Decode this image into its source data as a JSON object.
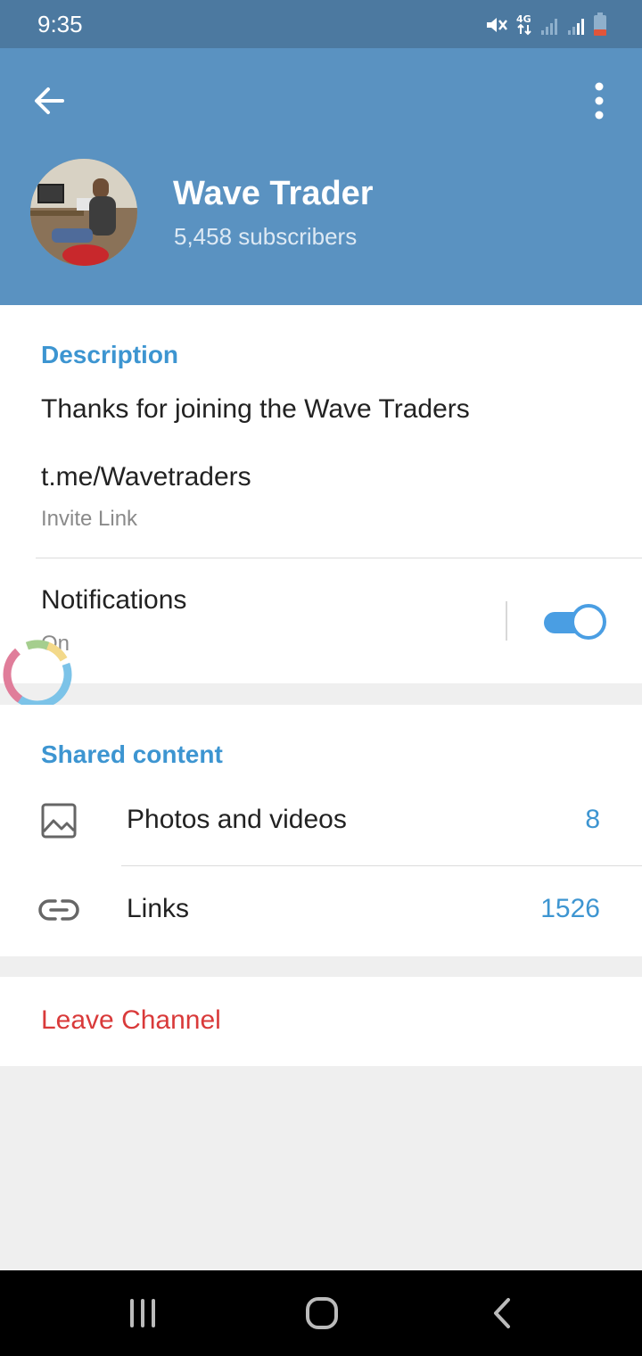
{
  "status_bar": {
    "time": "9:35",
    "icons": [
      "mute-icon",
      "4g-icon",
      "signal-icon",
      "signal-icon",
      "battery-icon"
    ]
  },
  "header": {
    "title": "Wave Trader",
    "subtitle": "5,458 subscribers",
    "accent_color": "#5a92c1"
  },
  "info": {
    "description_title": "Description",
    "description_text": "Thanks for joining the Wave Traders",
    "invite_link": "t.me/Wavetraders",
    "invite_link_label": "Invite Link",
    "notifications_label": "Notifications",
    "notifications_status": "On",
    "notifications_enabled": true
  },
  "shared": {
    "title": "Shared content",
    "rows": [
      {
        "icon": "image-icon",
        "label": "Photos and videos",
        "count": "8"
      },
      {
        "icon": "link-icon",
        "label": "Links",
        "count": "1526"
      }
    ]
  },
  "leave": {
    "label": "Leave Channel",
    "color": "#d93a3a"
  },
  "nav": {
    "buttons": [
      "recents-icon",
      "home-icon",
      "back-icon"
    ]
  }
}
